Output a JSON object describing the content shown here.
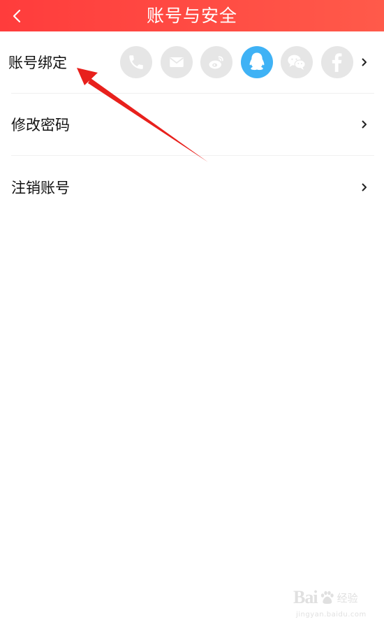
{
  "header": {
    "title": "账号与安全",
    "back_icon": "chevron-left-icon"
  },
  "rows": [
    {
      "label": "账号绑定"
    },
    {
      "label": "修改密码"
    },
    {
      "label": "注销账号"
    }
  ],
  "bind_icons": [
    {
      "icon": "phone-icon",
      "active": false
    },
    {
      "icon": "mail-icon",
      "active": false
    },
    {
      "icon": "weibo-icon",
      "active": false
    },
    {
      "icon": "qq-icon",
      "active": true
    },
    {
      "icon": "wechat-icon",
      "active": false
    },
    {
      "icon": "facebook-icon",
      "active": false
    }
  ],
  "watermark": {
    "logo_text": "Bai",
    "logo_suffix": "经验",
    "url": "jingyan.baidu.com"
  },
  "colors": {
    "header_start": "#ff3c3c",
    "header_end": "#ff5a4a",
    "icon_inactive_bg": "#e6e6e6",
    "qq_active_bg": "#3fb2f5",
    "annotation_arrow": "#e8201c"
  }
}
